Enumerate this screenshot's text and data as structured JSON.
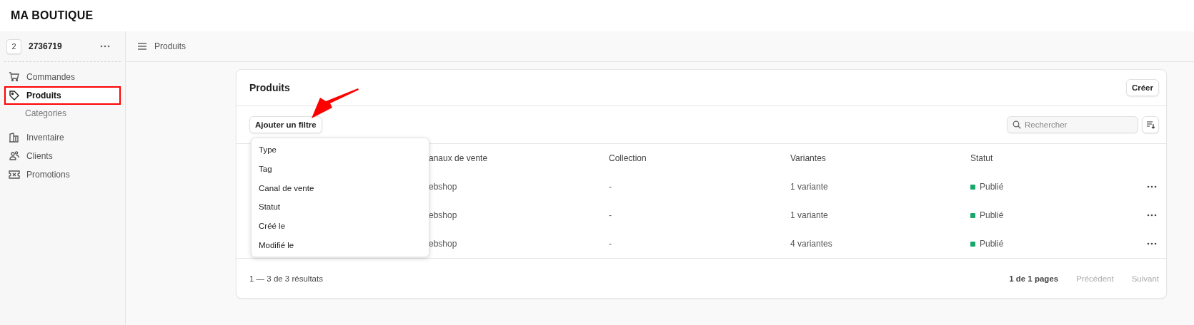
{
  "brand": "MA BOUTIQUE",
  "workspace": {
    "badge": "2",
    "name": "2736719"
  },
  "sidebar": {
    "items": [
      {
        "label": "Commandes",
        "kind": "cart",
        "selected": false,
        "highlighted": false
      },
      {
        "label": "Produits",
        "kind": "tag",
        "selected": true,
        "highlighted": true,
        "children": [
          {
            "label": "Categories",
            "selected": false
          }
        ]
      },
      {
        "label": "Inventaire",
        "kind": "building",
        "selected": false,
        "highlighted": false
      },
      {
        "label": "Clients",
        "kind": "users",
        "selected": false,
        "highlighted": false
      },
      {
        "label": "Promotions",
        "kind": "ticket",
        "selected": false,
        "highlighted": false
      }
    ]
  },
  "breadcrumb": "Produits",
  "card": {
    "title": "Produits",
    "create_button": "Créer",
    "filter_button": "Ajouter un filtre",
    "search": {
      "placeholder": "Rechercher"
    },
    "table": {
      "columns": [
        "anaux de vente",
        "Collection",
        "Variantes",
        "Statut"
      ],
      "rows": [
        {
          "cells": [
            "ebshop",
            "-",
            "1 variante"
          ],
          "status": "Publié",
          "color": "#1aa76e"
        },
        {
          "cells": [
            "ebshop",
            "-",
            "1 variante"
          ],
          "status": "Publié",
          "color": "#1aa76e"
        },
        {
          "cells": [
            "ebshop",
            "-",
            "4 variantes"
          ],
          "status": "Publié",
          "color": "#1aa76e"
        }
      ]
    },
    "footer": {
      "results": "1 — 3 de 3 résultats",
      "pages": "1 de 1 pages",
      "previous": {
        "label": "Précédent",
        "disabled": true
      },
      "next": {
        "label": "Suivant",
        "disabled": true
      }
    }
  },
  "filter_menu": {
    "items": [
      "Type",
      "Tag",
      "Canal de vente",
      "Statut",
      "Créé le",
      "Modifié le"
    ]
  },
  "annotations": [
    {
      "kind": "arrow"
    }
  ]
}
